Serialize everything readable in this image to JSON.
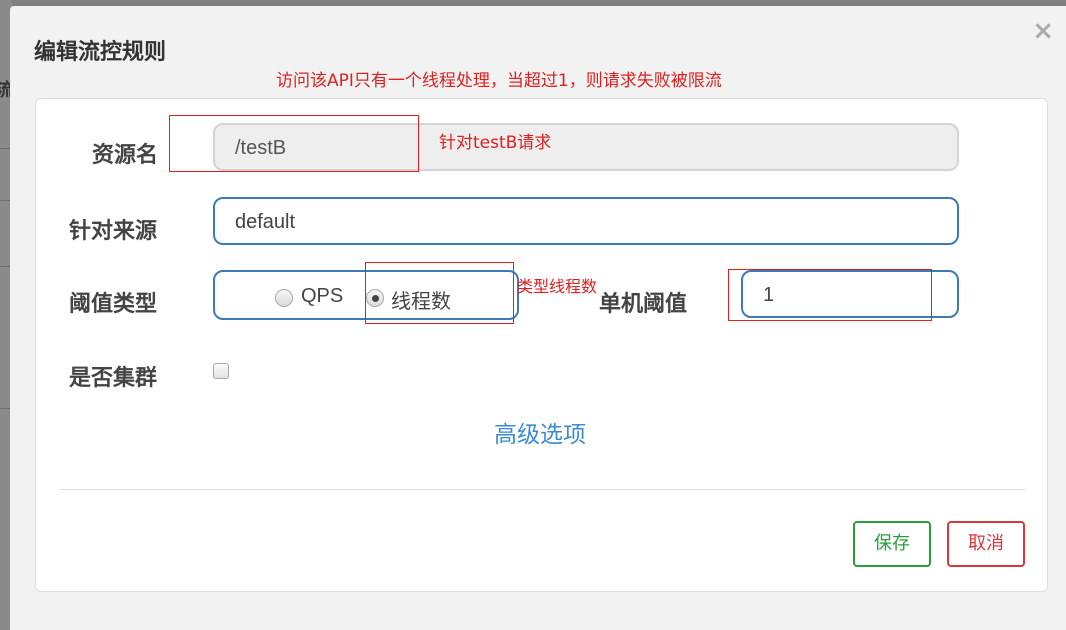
{
  "background": {
    "glyph": "流"
  },
  "dialog": {
    "title": "编辑流控规则",
    "close_glyph": "×"
  },
  "annotations": {
    "top_note": "访问该API只有一个线程处理，当超过1，则请求失败被限流",
    "resource_note": "针对testB请求",
    "type_note": "类型线程数"
  },
  "form": {
    "resource_label": "资源名",
    "resource_value": "/testB",
    "origin_label": "针对来源",
    "origin_value": "default",
    "threshold_type_label": "阈值类型",
    "threshold_type_options": [
      "QPS",
      "线程数"
    ],
    "threshold_type_selected": "线程数",
    "single_threshold_label": "单机阈值",
    "single_threshold_value": "1",
    "cluster_label": "是否集群",
    "cluster_checked": false,
    "advanced_link": "高级选项"
  },
  "buttons": {
    "save": "保存",
    "cancel": "取消"
  },
  "colors": {
    "accent_blue": "#3d7bb5",
    "link_blue": "#3d8bd0",
    "save_green": "#2a9d3a",
    "cancel_red": "#d9363e",
    "annotation_red": "#e02020"
  }
}
